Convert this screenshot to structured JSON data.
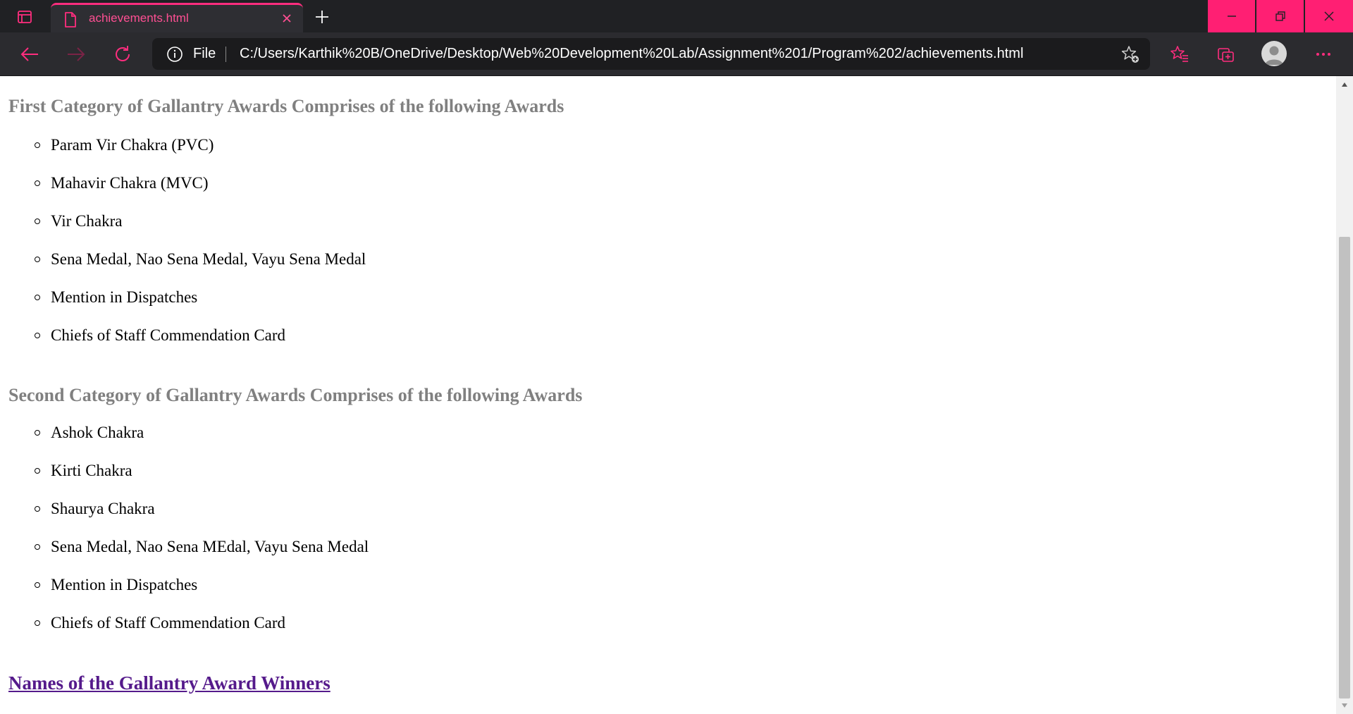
{
  "tab": {
    "title": "achievements.html"
  },
  "toolbar": {
    "scheme_label": "File",
    "url": "C:/Users/Karthik%20B/OneDrive/Desktop/Web%20Development%20Lab/Assignment%201/Program%202/achievements.html"
  },
  "theme": {
    "accent": "#ff1f73",
    "chrome_bg": "#202124",
    "toolbar_bg": "#2b2b2f"
  },
  "page": {
    "section1": {
      "heading": "First Category of Gallantry Awards Comprises of the following Awards",
      "items": [
        "Param Vir Chakra (PVC)",
        "Mahavir Chakra (MVC)",
        "Vir Chakra",
        "Sena Medal, Nao Sena Medal, Vayu Sena Medal",
        "Mention in Dispatches",
        "Chiefs of Staff Commendation Card"
      ]
    },
    "section2": {
      "heading": "Second Category of Gallantry Awards Comprises of the following Awards",
      "items": [
        "Ashok Chakra",
        "Kirti Chakra",
        "Shaurya Chakra",
        "Sena Medal, Nao Sena MEdal, Vayu Sena Medal",
        "Mention in Dispatches",
        "Chiefs of Staff Commendation Card"
      ]
    },
    "winners_link": "Names of the Gallantry Award Winners"
  }
}
